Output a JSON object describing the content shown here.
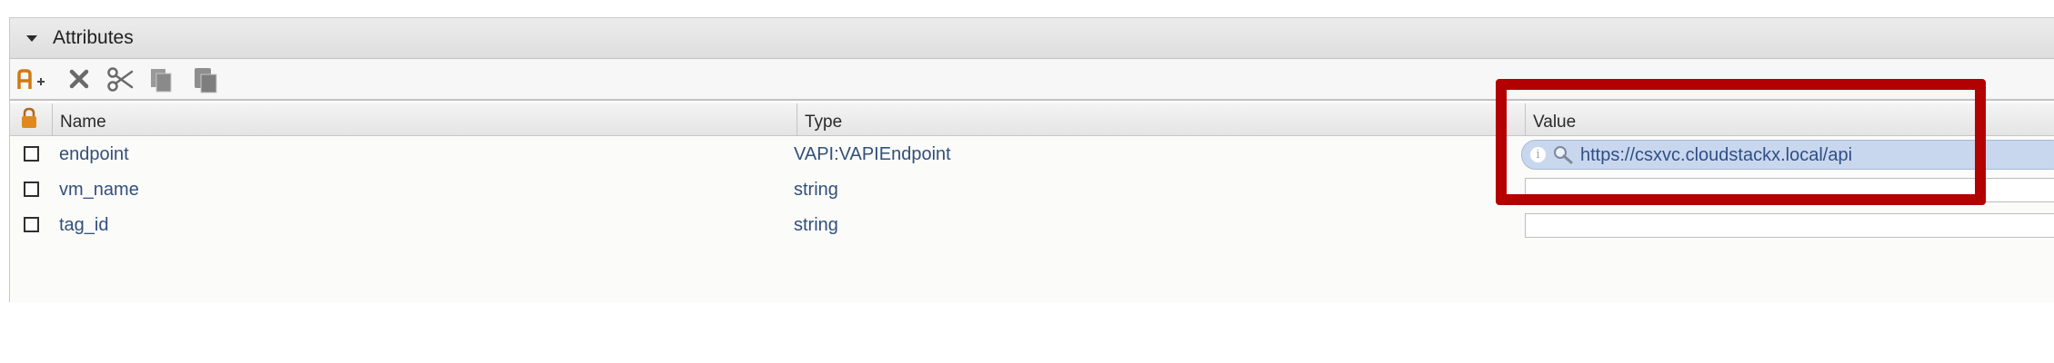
{
  "panel": {
    "title": "Attributes",
    "collapse_icon": "triangle-down-icon"
  },
  "toolbar": {
    "buttons": [
      {
        "name": "add-attribute-button",
        "icon": "add-attribute-icon"
      },
      {
        "name": "delete-button",
        "icon": "delete-x-icon"
      },
      {
        "name": "cut-button",
        "icon": "scissors-icon"
      },
      {
        "name": "copy-button",
        "icon": "copy-icon"
      },
      {
        "name": "paste-button",
        "icon": "paste-icon"
      }
    ]
  },
  "grid": {
    "lock_icon": "lock-icon",
    "columns": {
      "name": "Name",
      "type": "Type",
      "value": "Value"
    },
    "rows": [
      {
        "name": "endpoint",
        "type": "VAPI:VAPIEndpoint",
        "value": "https://csxvc.cloudstackx.local/api",
        "checked": false
      },
      {
        "name": "vm_name",
        "type": "string",
        "value": "",
        "checked": false
      },
      {
        "name": "tag_id",
        "type": "string",
        "value": "",
        "checked": false
      }
    ]
  },
  "value_pill": {
    "info_glyph": "i",
    "icon": "magnifier-icon"
  },
  "colors": {
    "link_text": "#32507a",
    "highlight": "#b30000",
    "pill_background": "#c9d7ee"
  }
}
